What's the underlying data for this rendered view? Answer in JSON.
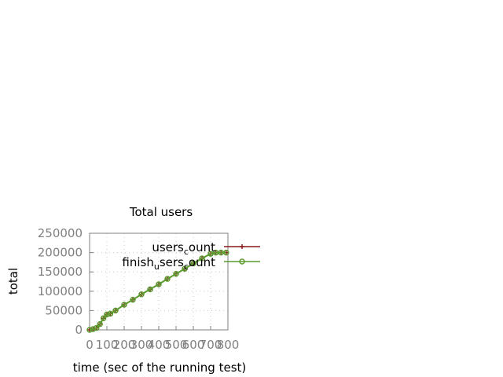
{
  "chart_data": {
    "type": "line",
    "title": "Total users",
    "xlabel": "time (sec of the running test)",
    "ylabel": "total",
    "xlim": [
      0,
      800
    ],
    "ylim": [
      0,
      250000
    ],
    "xticks": [
      "0",
      "100",
      "200",
      "300",
      "400",
      "500",
      "600",
      "700",
      "800"
    ],
    "yticks": [
      "0",
      "50000",
      "100000",
      "150000",
      "200000",
      "250000"
    ],
    "grid": true,
    "legend_position": "top-right",
    "series": [
      {
        "name": "users_count",
        "color": "#8b1a1a",
        "marker": "plus",
        "x": [
          0,
          20,
          40,
          60,
          80,
          100,
          120,
          150,
          200,
          250,
          300,
          350,
          400,
          450,
          500,
          550,
          600,
          650,
          700,
          730,
          760,
          790
        ],
        "y": [
          0,
          2000,
          5000,
          15000,
          30000,
          40000,
          42000,
          50000,
          65000,
          78000,
          92000,
          105000,
          118000,
          132000,
          145000,
          158000,
          172000,
          185000,
          197000,
          200000,
          200000,
          200000
        ]
      },
      {
        "name": "finish_users_count",
        "color": "#5b9b2f",
        "marker": "circle",
        "x": [
          0,
          20,
          40,
          60,
          80,
          100,
          120,
          150,
          200,
          250,
          300,
          350,
          400,
          450,
          500,
          550,
          600,
          650,
          700,
          730,
          760,
          790
        ],
        "y": [
          0,
          2000,
          5000,
          15000,
          30000,
          40000,
          42000,
          50000,
          65000,
          78000,
          92000,
          105000,
          118000,
          132000,
          145000,
          158000,
          172000,
          185000,
          197000,
          200000,
          200000,
          200000
        ]
      }
    ],
    "legend": [
      {
        "text": "users",
        "sub": "c",
        "tail": "ount"
      },
      {
        "text": "finish",
        "sub": "u",
        "tail": "sers",
        "sub2": "c",
        "tail2": "ount"
      }
    ]
  }
}
